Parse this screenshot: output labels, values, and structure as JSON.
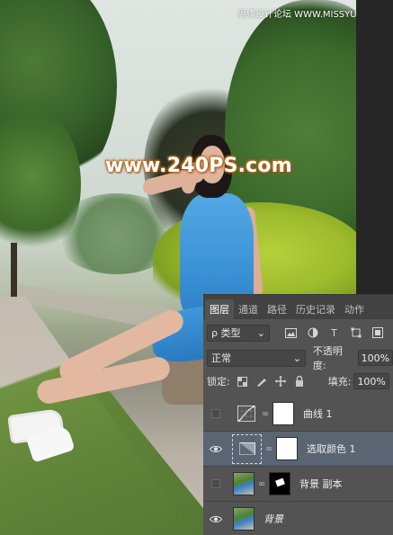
{
  "watermark": "www.240PS.com",
  "credit": "思缘设计论坛  WWW.MISSYUAN.COM",
  "panel": {
    "tabs": [
      "图层",
      "通道",
      "路径",
      "历史记录",
      "动作"
    ],
    "active_tab": "图层",
    "filter_label": "ρ 类型",
    "filter_arrow": "⌄",
    "blend_mode": "正常",
    "opacity_label": "不透明度:",
    "opacity_value": "100%",
    "lock_label": "锁定:",
    "fill_label": "填充:",
    "fill_value": "100%",
    "layers": [
      {
        "name": "曲线 1",
        "visible": false,
        "type": "curves-adjustment"
      },
      {
        "name": "选取颜色 1",
        "visible": true,
        "type": "selective-color-adjustment",
        "selected": true
      },
      {
        "name": "背景 副本",
        "visible": false,
        "type": "photo-with-mask"
      },
      {
        "name": "背景",
        "visible": true,
        "type": "photo"
      }
    ]
  },
  "colors": {
    "panel_bg": "#535353",
    "tabbar_bg": "#424242",
    "selected_layer": "#5a6472",
    "dress": "#3b92d6",
    "watermark_glow": "#b86b1f"
  }
}
